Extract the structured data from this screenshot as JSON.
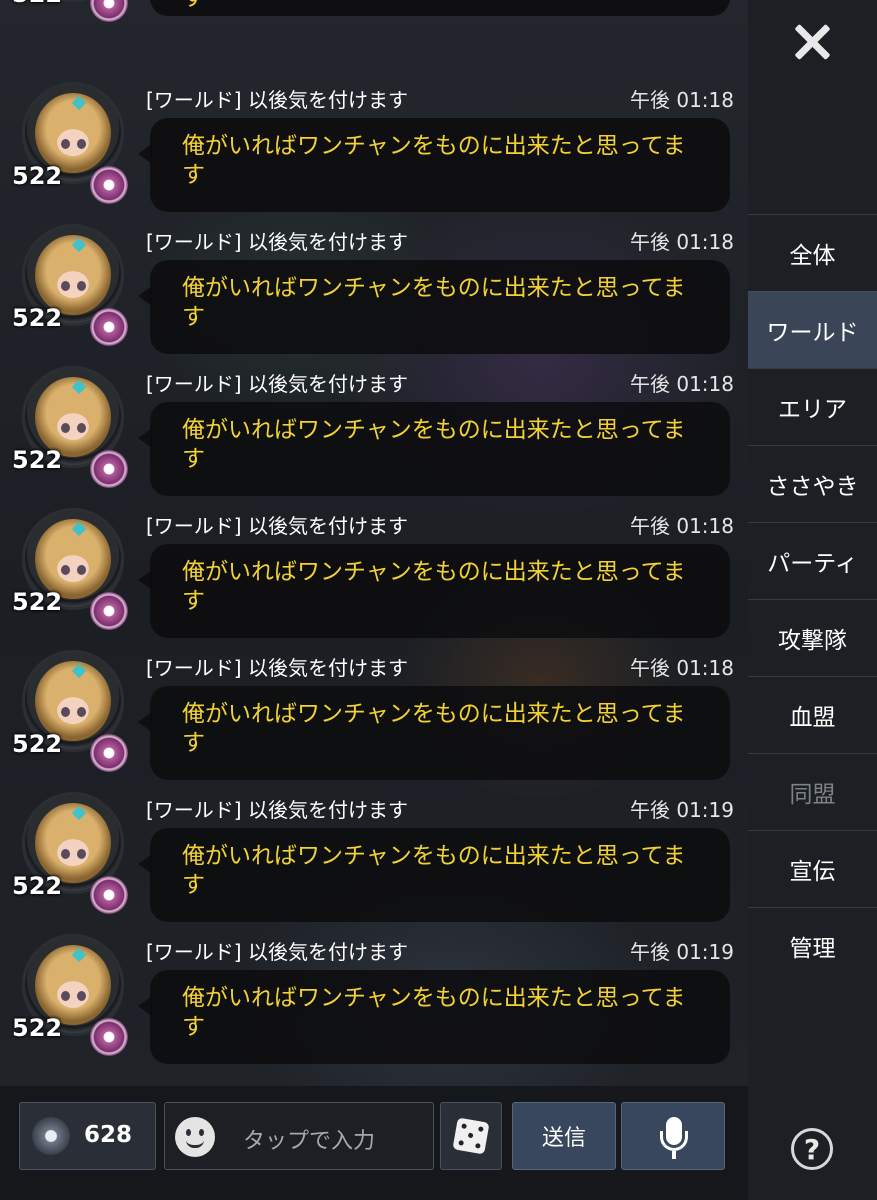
{
  "chat": {
    "partial_top": {
      "level": "522",
      "text_tail": "す"
    },
    "messages": [
      {
        "channel": "[ワールド] 以後気を付けます",
        "time": "午後 01:18",
        "text": "俺がいればワンチャンをものに出来たと思ってます",
        "level": "522"
      },
      {
        "channel": "[ワールド] 以後気を付けます",
        "time": "午後 01:18",
        "text": "俺がいればワンチャンをものに出来たと思ってます",
        "level": "522"
      },
      {
        "channel": "[ワールド] 以後気を付けます",
        "time": "午後 01:18",
        "text": "俺がいればワンチャンをものに出来たと思ってます",
        "level": "522"
      },
      {
        "channel": "[ワールド] 以後気を付けます",
        "time": "午後 01:18",
        "text": "俺がいればワンチャンをものに出来たと思ってます",
        "level": "522"
      },
      {
        "channel": "[ワールド] 以後気を付けます",
        "time": "午後 01:18",
        "text": "俺がいればワンチャンをものに出来たと思ってます",
        "level": "522"
      },
      {
        "channel": "[ワールド] 以後気を付けます",
        "time": "午後 01:19",
        "text": "俺がいればワンチャンをものに出来たと思ってます",
        "level": "522"
      },
      {
        "channel": "[ワールド] 以後気を付けます",
        "time": "午後 01:19",
        "text": "俺がいればワンチャンをものに出来たと思ってます",
        "level": "522"
      }
    ]
  },
  "tabs": [
    {
      "label": "全体",
      "active": false,
      "enabled": true
    },
    {
      "label": "ワールド",
      "active": true,
      "enabled": true
    },
    {
      "label": "エリア",
      "active": false,
      "enabled": true
    },
    {
      "label": "ささやき",
      "active": false,
      "enabled": true
    },
    {
      "label": "パーティ",
      "active": false,
      "enabled": true
    },
    {
      "label": "攻撃隊",
      "active": false,
      "enabled": true
    },
    {
      "label": "血盟",
      "active": false,
      "enabled": true
    },
    {
      "label": "同盟",
      "active": false,
      "enabled": false
    },
    {
      "label": "宣伝",
      "active": false,
      "enabled": true
    },
    {
      "label": "管理",
      "active": false,
      "enabled": true
    }
  ],
  "icons": {
    "close": "close-icon",
    "help": "help-icon",
    "gem": "gem-icon",
    "emoji": "smiley-icon",
    "dice": "dice-icon",
    "mic": "microphone-icon"
  },
  "help_label": "?",
  "bottom_bar": {
    "currency_value": "628",
    "input_placeholder": "タップで入力",
    "send_label": "送信"
  },
  "colors": {
    "message_text": "#f2d233",
    "active_tab": "#3a4657",
    "button": "#38475d"
  }
}
